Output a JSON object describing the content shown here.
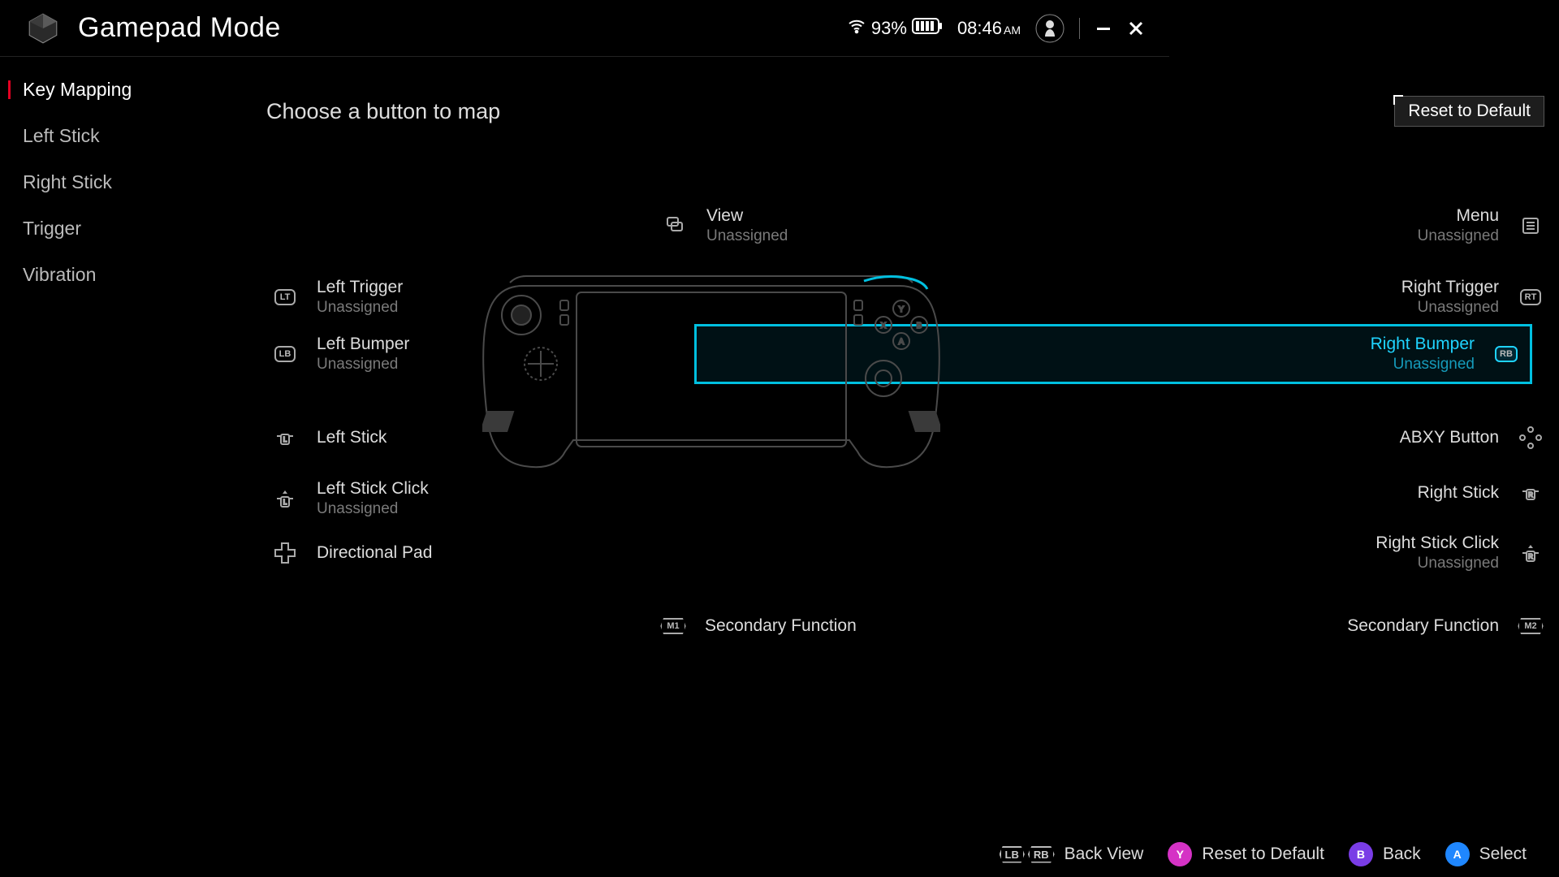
{
  "header": {
    "title": "Gamepad Mode",
    "battery_pct": "93%",
    "time": "08:46",
    "ampm": "AM"
  },
  "sidebar": [
    {
      "label": "Key Mapping",
      "active": true
    },
    {
      "label": "Left Stick",
      "active": false
    },
    {
      "label": "Right Stick",
      "active": false
    },
    {
      "label": "Trigger",
      "active": false
    },
    {
      "label": "Vibration",
      "active": false
    }
  ],
  "main": {
    "title": "Choose a button to map",
    "reset_label": "Reset to Default",
    "unassigned": "Unassigned"
  },
  "buttons": {
    "view": {
      "name": "View",
      "key": ""
    },
    "menu": {
      "name": "Menu",
      "key": ""
    },
    "lt": {
      "name": "Left Trigger",
      "key": "LT"
    },
    "rt": {
      "name": "Right Trigger",
      "key": "RT"
    },
    "lb": {
      "name": "Left Bumper",
      "key": "LB"
    },
    "rb": {
      "name": "Right Bumper",
      "key": "RB",
      "selected": true
    },
    "ls": {
      "name": "Left Stick"
    },
    "abxy": {
      "name": "ABXY Button"
    },
    "lsc": {
      "name": "Left Stick Click"
    },
    "rs": {
      "name": "Right Stick"
    },
    "dpad": {
      "name": "Directional Pad"
    },
    "rsc": {
      "name": "Right Stick Click"
    },
    "m1": {
      "name": "Secondary Function",
      "key": "M1"
    },
    "m2": {
      "name": "Secondary Function",
      "key": "M2"
    }
  },
  "footer": {
    "backview": {
      "label": "Back View",
      "key1": "LB",
      "key2": "RB"
    },
    "reset": {
      "label": "Reset to Default",
      "key": "Y"
    },
    "back": {
      "label": "Back",
      "key": "B"
    },
    "select": {
      "label": "Select",
      "key": "A"
    }
  }
}
